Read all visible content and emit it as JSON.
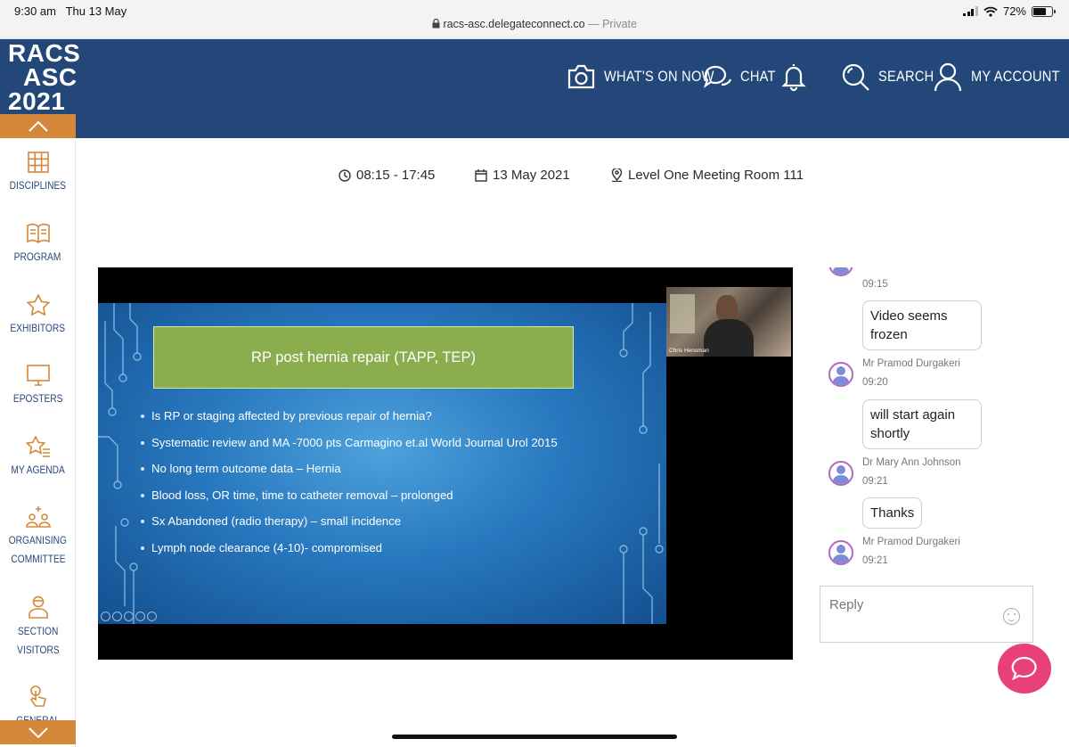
{
  "status_bar": {
    "time": "9:30 am",
    "date": "Thu 13 May",
    "url": "racs-asc.delegateconnect.co",
    "private_label": "— Private",
    "battery": "72%",
    "battery_level_percent": 72
  },
  "logo": {
    "line1": "RACS",
    "line2": "ASC",
    "line3": "2021"
  },
  "nav": {
    "whats_on": "WHAT'S ON NOW",
    "chat": "CHAT",
    "search": "SEARCH",
    "account": "MY ACCOUNT"
  },
  "sidebar": {
    "items": [
      {
        "label": "DISCIPLINES",
        "icon": "grid-icon"
      },
      {
        "label": "PROGRAM",
        "icon": "book-icon"
      },
      {
        "label": "EXHIBITORS",
        "icon": "star-icon"
      },
      {
        "label": "EPOSTERS",
        "icon": "monitor-icon"
      },
      {
        "label": "MY AGENDA",
        "icon": "star-list-icon"
      },
      {
        "label": "ORGANISING",
        "label2": "COMMITTEE",
        "icon": "people-icon"
      },
      {
        "label": "SECTION",
        "label2": "VISITORS",
        "icon": "person-icon"
      },
      {
        "label": "GENERAL",
        "icon": "hand-icon"
      }
    ]
  },
  "session": {
    "time": "08:15 - 17:45",
    "date": "13 May 2021",
    "location": "Level One Meeting Room 111"
  },
  "slide": {
    "title": "RP post hernia repair (TAPP, TEP)",
    "bullets": [
      "Is RP or staging affected by previous repair of hernia?",
      "Systematic review and MA -7000 pts Carmagino et.al World Journal Urol 2015",
      "No long term outcome data – Hernia",
      "Blood loss, OR time, time to catheter removal – prolonged",
      "Sx Abandoned (radio therapy) – small incidence",
      "Lymph node clearance (4-10)- compromised"
    ],
    "presenter_name": "Chris Hensman"
  },
  "chat": {
    "top_time": "09:15",
    "messages": [
      {
        "text": "Video seems frozen",
        "author": "Mr Pramod Durgakeri",
        "time": "09:20"
      },
      {
        "text": "will start again shortly",
        "author": "Dr Mary Ann Johnson",
        "time": "09:21"
      },
      {
        "text": "Thanks",
        "author": "Mr Pramod Durgakeri",
        "time": "09:21"
      }
    ],
    "reply_placeholder": "Reply"
  },
  "colors": {
    "brand_blue": "#24477a",
    "accent_orange": "#d6883a",
    "slide_green": "#8aad4e",
    "fab_pink": "#e8407a"
  }
}
